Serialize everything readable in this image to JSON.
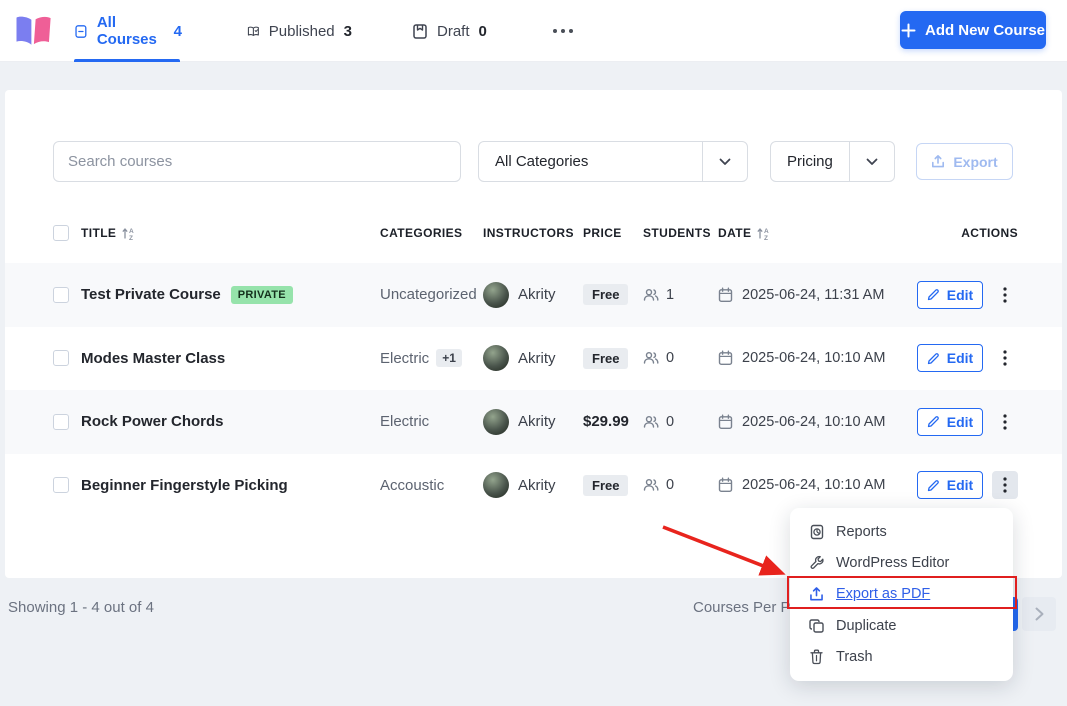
{
  "colors": {
    "accent": "#2469f2",
    "annotation_red": "#e01f1f",
    "private_badge_bg": "#96e3ab"
  },
  "header": {
    "tabs": [
      {
        "label": "All Courses",
        "count": "4"
      },
      {
        "label": "Published",
        "count": "3"
      },
      {
        "label": "Draft",
        "count": "0"
      }
    ],
    "add_course_button": "Add New Course"
  },
  "filters": {
    "search_placeholder": "Search courses",
    "category_selected": "All Categories",
    "pricing_selected": "Pricing",
    "export_label": "Export"
  },
  "table": {
    "columns": {
      "title": "TITLE",
      "categories": "CATEGORIES",
      "instructors": "INSTRUCTORS",
      "price": "PRICE",
      "students": "STUDENTS",
      "date": "DATE",
      "actions": "ACTIONS"
    },
    "edit_label": "Edit",
    "rows": [
      {
        "title": "Test Private Course",
        "status_badge": "PRIVATE",
        "categories": "Uncategorized",
        "instructor": "Akrity",
        "price": "Free",
        "students": "1",
        "date": "2025-06-24, 11:31 AM"
      },
      {
        "title": "Modes Master Class",
        "categories": "Electric",
        "categories_extra": "+1",
        "instructor": "Akrity",
        "price": "Free",
        "students": "0",
        "date": "2025-06-24, 10:10 AM"
      },
      {
        "title": "Rock Power Chords",
        "categories": "Electric",
        "instructor": "Akrity",
        "price": "$29.99",
        "students": "0",
        "date": "2025-06-24, 10:10 AM"
      },
      {
        "title": "Beginner Fingerstyle Picking",
        "categories": "Accoustic",
        "instructor": "Akrity",
        "price": "Free",
        "students": "0",
        "date": "2025-06-24, 10:10 AM"
      }
    ]
  },
  "context_menu": {
    "items": [
      {
        "label": "Reports"
      },
      {
        "label": "WordPress Editor"
      },
      {
        "label": "Export as PDF"
      },
      {
        "label": "Duplicate"
      },
      {
        "label": "Trash"
      }
    ],
    "highlighted_item": "Export as PDF"
  },
  "footer": {
    "showing": "Showing 1 - 4 out of 4",
    "per_page_label": "Courses Per Pag"
  }
}
